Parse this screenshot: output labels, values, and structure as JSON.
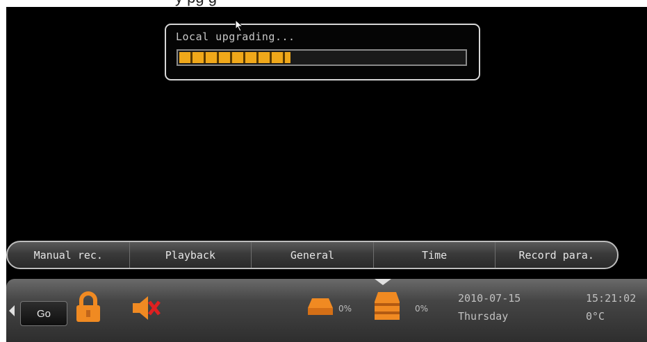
{
  "caption_fragment": "y          pg       g",
  "dialog": {
    "title": "Local upgrading...",
    "progress_fraction": 0.39
  },
  "menu": {
    "items": [
      {
        "label": "Manual rec."
      },
      {
        "label": "Playback"
      },
      {
        "label": "General"
      },
      {
        "label": "Time"
      },
      {
        "label": "Record para."
      }
    ]
  },
  "status": {
    "go_label": "Go",
    "hdd1_label": "0%",
    "hdd2_label": "0%",
    "date": "2010-07-15",
    "day": "Thursday",
    "time": "15:21:02",
    "temperature": "0°C"
  },
  "colors": {
    "accent": "#f08a22",
    "progress": "#f0a81a"
  },
  "icons": [
    "lock-icon",
    "mute-icon",
    "hdd-icon",
    "hdd-icon",
    "chevron-down-icon",
    "arrow-left-icon",
    "cursor-icon"
  ]
}
